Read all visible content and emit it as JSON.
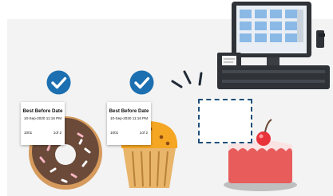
{
  "labels": [
    {
      "title": "Best Before Date",
      "date": "10-Sep-2020 11:16 PM",
      "code": "1001",
      "page": "1of 2"
    },
    {
      "title": "Best Before Date",
      "date": "10-Sep-2020 11:16 PM",
      "code": "1001",
      "page": "1of 2"
    }
  ],
  "items": [
    {
      "name": "donut",
      "status": "labeled"
    },
    {
      "name": "muffin",
      "status": "labeled"
    },
    {
      "name": "cake",
      "status": "unlabeled"
    }
  ],
  "colors": {
    "check": "#1c6fb0",
    "dashed_border": "#1f4f7a",
    "pos_screen": "#8ab9e6",
    "donut_frosting": "#6b4a39",
    "muffin": "#f5a623",
    "cake": "#e85c5c",
    "cherry": "#e8333a"
  },
  "icons": [
    "checkmark-circle-icon",
    "checkmark-circle-icon",
    "pos-terminal-icon",
    "receipt-printer-icon"
  ]
}
